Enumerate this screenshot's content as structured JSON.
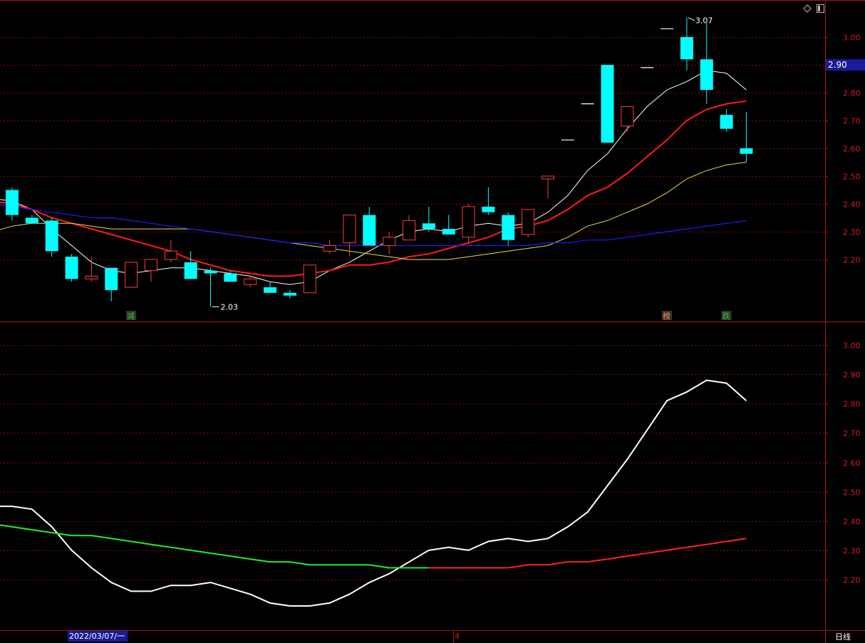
{
  "chart_data": [
    {
      "type": "candlestick",
      "panel": "price",
      "ylim": [
        2.1,
        3.07
      ],
      "yticks": [
        "3.00",
        "2.90",
        "2.80",
        "2.70",
        "2.60",
        "2.50",
        "2.40",
        "2.30",
        "2.20"
      ],
      "current_price": "2.90",
      "high_label": "3.07",
      "low_label": "2.03",
      "colors": {
        "up": "#ff3b3b",
        "down": "#00ffff",
        "ma5": "#ffffff",
        "ma10": "#ff1a1a",
        "ma20": "#e0e040",
        "ma60": "#1a1aff",
        "grid": "#7a0c0c",
        "border": "#b01515"
      },
      "candles": [
        {
          "o": 2.45,
          "h": 2.46,
          "l": 2.34,
          "c": 2.36
        },
        {
          "o": 2.35,
          "h": 2.36,
          "l": 2.33,
          "c": 2.33
        },
        {
          "o": 2.34,
          "h": 2.35,
          "l": 2.21,
          "c": 2.23
        },
        {
          "o": 2.21,
          "h": 2.22,
          "l": 2.12,
          "c": 2.13
        },
        {
          "o": 2.13,
          "h": 2.21,
          "l": 2.12,
          "c": 2.14
        },
        {
          "o": 2.17,
          "h": 2.17,
          "l": 2.05,
          "c": 2.09
        },
        {
          "o": 2.1,
          "h": 2.19,
          "l": 2.1,
          "c": 2.19
        },
        {
          "o": 2.16,
          "h": 2.2,
          "l": 2.12,
          "c": 2.2
        },
        {
          "o": 2.2,
          "h": 2.27,
          "l": 2.19,
          "c": 2.23
        },
        {
          "o": 2.19,
          "h": 2.23,
          "l": 2.13,
          "c": 2.13
        },
        {
          "o": 2.16,
          "h": 2.17,
          "l": 2.03,
          "c": 2.15
        },
        {
          "o": 2.15,
          "h": 2.16,
          "l": 2.12,
          "c": 2.12
        },
        {
          "o": 2.11,
          "h": 2.14,
          "l": 2.1,
          "c": 2.13
        },
        {
          "o": 2.1,
          "h": 2.12,
          "l": 2.08,
          "c": 2.08
        },
        {
          "o": 2.08,
          "h": 2.09,
          "l": 2.06,
          "c": 2.07
        },
        {
          "o": 2.08,
          "h": 2.18,
          "l": 2.08,
          "c": 2.18
        },
        {
          "o": 2.23,
          "h": 2.27,
          "l": 2.22,
          "c": 2.25
        },
        {
          "o": 2.26,
          "h": 2.36,
          "l": 2.21,
          "c": 2.36
        },
        {
          "o": 2.36,
          "h": 2.39,
          "l": 2.25,
          "c": 2.25
        },
        {
          "o": 2.25,
          "h": 2.3,
          "l": 2.22,
          "c": 2.28
        },
        {
          "o": 2.27,
          "h": 2.36,
          "l": 2.27,
          "c": 2.34
        },
        {
          "o": 2.33,
          "h": 2.39,
          "l": 2.3,
          "c": 2.31
        },
        {
          "o": 2.31,
          "h": 2.36,
          "l": 2.29,
          "c": 2.29
        },
        {
          "o": 2.28,
          "h": 2.4,
          "l": 2.26,
          "c": 2.39
        },
        {
          "o": 2.39,
          "h": 2.46,
          "l": 2.36,
          "c": 2.37
        },
        {
          "o": 2.36,
          "h": 2.37,
          "l": 2.25,
          "c": 2.27
        },
        {
          "o": 2.29,
          "h": 2.38,
          "l": 2.28,
          "c": 2.38
        },
        {
          "o": 2.49,
          "h": 2.5,
          "l": 2.42,
          "c": 2.5
        },
        {
          "o": 2.63,
          "h": 2.63,
          "l": 2.63,
          "c": 2.63
        },
        {
          "o": 2.76,
          "h": 2.76,
          "l": 2.76,
          "c": 2.76
        },
        {
          "o": 2.9,
          "h": 2.9,
          "l": 2.62,
          "c": 2.62
        },
        {
          "o": 2.68,
          "h": 2.75,
          "l": 2.66,
          "c": 2.75
        },
        {
          "o": 2.89,
          "h": 2.89,
          "l": 2.89,
          "c": 2.89
        },
        {
          "o": 3.03,
          "h": 3.03,
          "l": 3.03,
          "c": 3.03
        },
        {
          "o": 3.0,
          "h": 3.07,
          "l": 2.88,
          "c": 2.92
        },
        {
          "o": 2.92,
          "h": 3.05,
          "l": 2.76,
          "c": 2.81
        },
        {
          "o": 2.72,
          "h": 2.74,
          "l": 2.66,
          "c": 2.67
        },
        {
          "o": 2.6,
          "h": 2.73,
          "l": 2.55,
          "c": 2.58
        }
      ],
      "series": [
        {
          "name": "MA5",
          "values": [
            2.42,
            2.41,
            2.38,
            2.31,
            2.25,
            2.19,
            2.16,
            2.15,
            2.16,
            2.17,
            2.17,
            2.16,
            2.15,
            2.14,
            2.12,
            2.11,
            2.12,
            2.16,
            2.19,
            2.23,
            2.27,
            2.3,
            2.31,
            2.3,
            2.32,
            2.33,
            2.32,
            2.33,
            2.37,
            2.43,
            2.52,
            2.58,
            2.67,
            2.75,
            2.81,
            2.84,
            2.88,
            2.87,
            2.81
          ]
        },
        {
          "name": "MA10",
          "values": [
            2.41,
            2.41,
            2.4,
            2.38,
            2.35,
            2.33,
            2.31,
            2.29,
            2.27,
            2.25,
            2.23,
            2.2,
            2.18,
            2.16,
            2.15,
            2.14,
            2.14,
            2.15,
            2.16,
            2.18,
            2.18,
            2.19,
            2.21,
            2.22,
            2.24,
            2.26,
            2.28,
            2.31,
            2.32,
            2.34,
            2.38,
            2.43,
            2.46,
            2.51,
            2.57,
            2.63,
            2.7,
            2.74,
            2.76,
            2.77
          ]
        },
        {
          "name": "MA20",
          "values": [
            2.3,
            2.32,
            2.33,
            2.33,
            2.33,
            2.32,
            2.31,
            2.31,
            2.31,
            2.31,
            2.31,
            2.3,
            2.29,
            2.28,
            2.27,
            2.26,
            2.25,
            2.24,
            2.23,
            2.22,
            2.21,
            2.2,
            2.2,
            2.2,
            2.21,
            2.22,
            2.23,
            2.24,
            2.25,
            2.28,
            2.32,
            2.34,
            2.37,
            2.4,
            2.44,
            2.49,
            2.52,
            2.54,
            2.55
          ]
        },
        {
          "name": "MA60",
          "values": [
            2.41,
            2.4,
            2.39,
            2.38,
            2.37,
            2.36,
            2.35,
            2.35,
            2.34,
            2.33,
            2.32,
            2.31,
            2.3,
            2.29,
            2.28,
            2.27,
            2.26,
            2.26,
            2.25,
            2.25,
            2.25,
            2.25,
            2.25,
            2.25,
            2.25,
            2.25,
            2.25,
            2.25,
            2.25,
            2.26,
            2.26,
            2.27,
            2.27,
            2.28,
            2.29,
            2.3,
            2.31,
            2.32,
            2.33,
            2.34
          ]
        }
      ],
      "markers": [
        {
          "index": 6,
          "text": "减",
          "color": "#22cc22"
        },
        {
          "index": 33,
          "text": "榜",
          "color": "#ff8844"
        },
        {
          "index": 36,
          "text": "跌",
          "color": "#22cc22"
        }
      ],
      "corner_icons": [
        "diamond-icon",
        "panel-toggle-icon"
      ]
    },
    {
      "type": "line",
      "panel": "indicator",
      "ylim": [
        2.1,
        3.07
      ],
      "yticks": [
        "3.00",
        "2.90",
        "2.80",
        "2.70",
        "2.60",
        "2.50",
        "2.40",
        "2.30",
        "2.20"
      ],
      "series": [
        {
          "values": [
            2.45,
            2.45,
            2.44,
            2.38,
            2.3,
            2.24,
            2.19,
            2.16,
            2.16,
            2.18,
            2.18,
            2.19,
            2.17,
            2.15,
            2.12,
            2.11,
            2.11,
            2.12,
            2.15,
            2.19,
            2.22,
            2.26,
            2.3,
            2.31,
            2.3,
            2.33,
            2.34,
            2.33,
            2.34,
            2.38,
            2.43,
            2.52,
            2.61,
            2.71,
            2.81,
            2.84,
            2.88,
            2.87,
            2.81
          ],
          "color": "#ffffff"
        },
        {
          "values": [
            2.39,
            2.39,
            2.39,
            2.38,
            2.37,
            2.36,
            2.35,
            2.35,
            2.34,
            2.33,
            2.32,
            2.31,
            2.3,
            2.29,
            2.28,
            2.27,
            2.26,
            2.26,
            2.25,
            2.25,
            2.25,
            2.25,
            2.24,
            2.24,
            2.24,
            2.24,
            2.24,
            2.24,
            2.24,
            2.25,
            2.25,
            2.26,
            2.26,
            2.27,
            2.28,
            2.29,
            2.3,
            2.31,
            2.32,
            2.33,
            2.34
          ],
          "colors_by_segment": {
            "down": "#22ee22",
            "up": "#ff2222"
          }
        }
      ]
    }
  ],
  "axis": {
    "date_label": "2022/03/07/一",
    "month_marker": "4",
    "period_label": "日线"
  }
}
